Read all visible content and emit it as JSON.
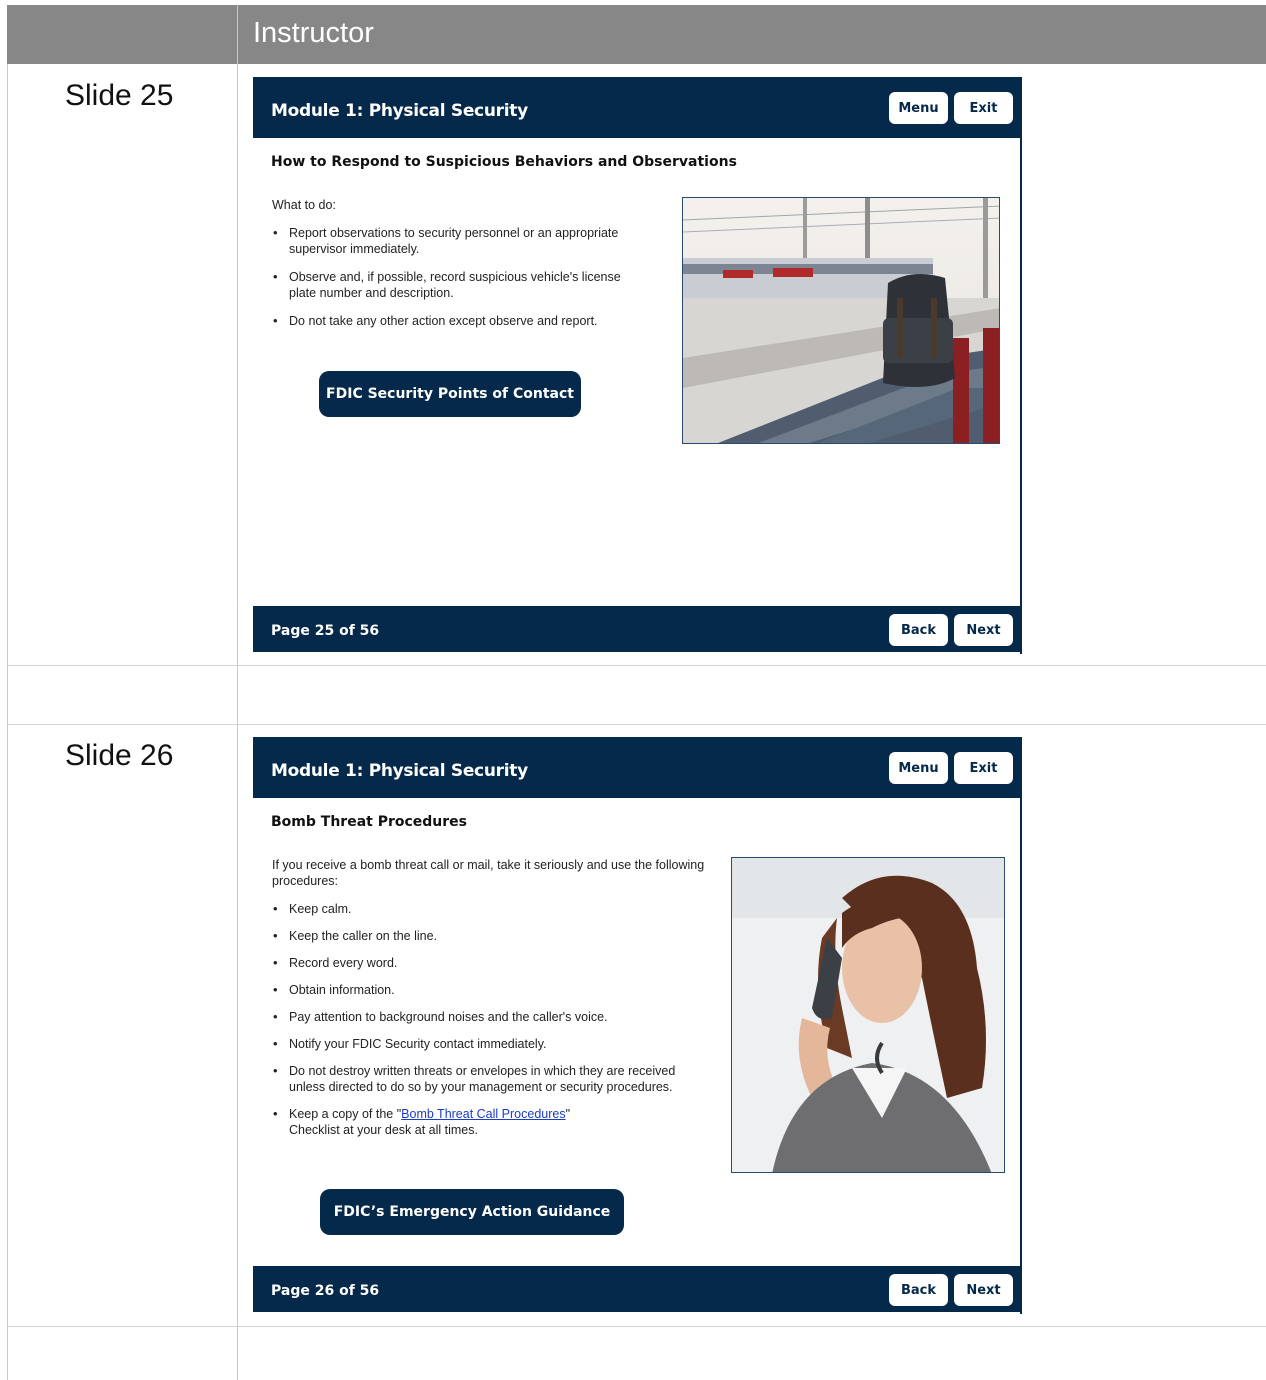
{
  "header": {
    "column_title": "Instructor"
  },
  "slides": [
    {
      "label": "Slide 25",
      "module_title": "Module 1: Physical Security",
      "menu_label": "Menu",
      "exit_label": "Exit",
      "heading": "How to Respond to Suspicious Behaviors and Observations",
      "intro": "What to do:",
      "bullets": [
        "Report observations to security personnel or an appropriate supervisor immediately.",
        "Observe and, if possible, record suspicious vehicle's license plate number and description.",
        "Do not take any other action except observe and report."
      ],
      "cta_label": "FDIC Security Points of Contact",
      "image_icon": "backpack-on-bench-photo",
      "page_label": "Page 25 of 56",
      "back_label": "Back",
      "next_label": "Next"
    },
    {
      "label": "Slide 26",
      "module_title": "Module 1: Physical Security",
      "menu_label": "Menu",
      "exit_label": "Exit",
      "heading": "Bomb Threat Procedures",
      "intro": "If you receive a bomb threat call or mail, take it seriously and use the following procedures:",
      "bullets": [
        "Keep calm.",
        "Keep the caller on the line.",
        "Record every word.",
        "Obtain information.",
        "Pay attention to background noises and the caller's voice.",
        "Notify your FDIC Security contact immediately.",
        "Do not destroy written threats or envelopes in which they are received unless directed to do so by your management or security procedures."
      ],
      "last_bullet_prefix": "Keep a copy of the \"",
      "last_bullet_link": "Bomb Threat Call Procedures",
      "last_bullet_suffix": "\" Checklist at your desk at all times.",
      "cta_label": "FDIC’s Emergency Action Guidance",
      "image_icon": "woman-on-phone-photo",
      "page_label": "Page 26 of 56",
      "back_label": "Back",
      "next_label": "Next"
    }
  ],
  "colors": {
    "navy": "#05294a",
    "header_gray": "#878787",
    "link": "#1a3cc7"
  }
}
